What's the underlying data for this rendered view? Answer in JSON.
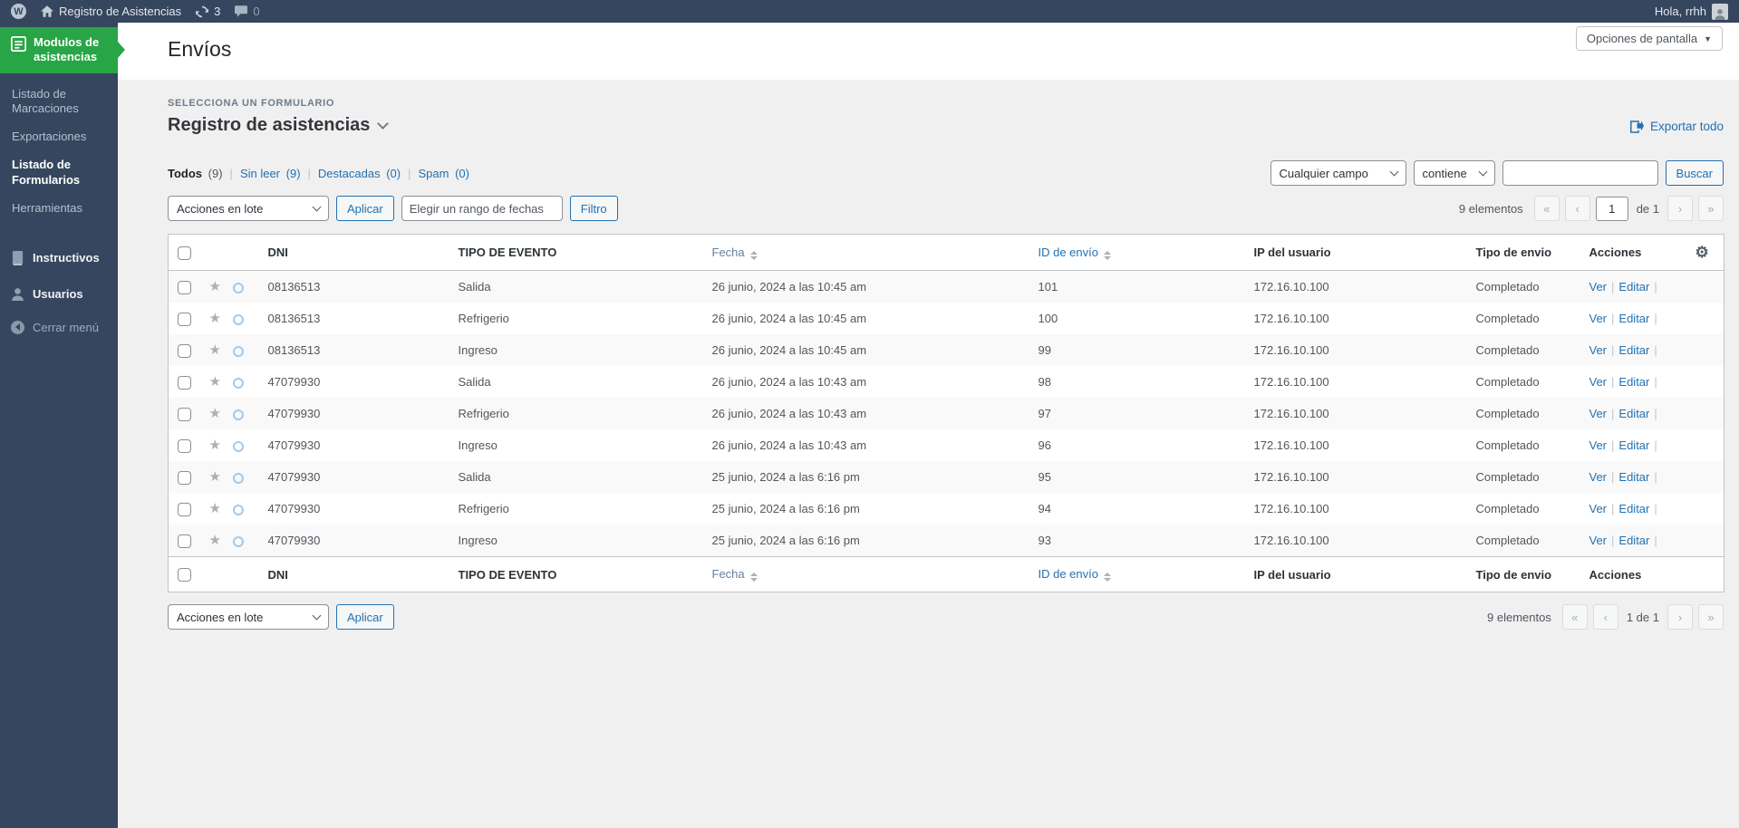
{
  "admin_bar": {
    "site_name": "Registro de Asistencias",
    "wp_logo": "W",
    "updates_count": "3",
    "comments_count": "0",
    "greeting": "Hola, rrhh"
  },
  "sidebar": {
    "main_item": "Modulos de asistencias",
    "submenu": [
      "Listado de Marcaciones",
      "Exportaciones",
      "Listado de Formularios",
      "Herramientas"
    ],
    "instructivos": "Instructivos",
    "usuarios": "Usuarios",
    "collapse": "Cerrar menú"
  },
  "page": {
    "title": "Envíos",
    "screen_options": "Opciones de pantalla",
    "form_selector_label": "Selecciona un formulario",
    "form_name": "Registro de asistencias",
    "export_all": "Exportar todo"
  },
  "views": [
    {
      "label": "Todos",
      "count": "(9)"
    },
    {
      "label": "Sin leer",
      "count": "(9)"
    },
    {
      "label": "Destacadas",
      "count": "(0)"
    },
    {
      "label": "Spam",
      "count": "(0)"
    }
  ],
  "search": {
    "field_select": "Cualquier campo",
    "operator_select": "contiene",
    "input_value": "",
    "button": "Buscar"
  },
  "bulk": {
    "actions_select": "Acciones en lote",
    "apply_button": "Aplicar",
    "date_placeholder": "Elegir un rango de fechas",
    "filter_button": "Filtro"
  },
  "pagination": {
    "items_text": "9 elementos",
    "first": "«",
    "prev": "‹",
    "next": "›",
    "last": "»",
    "top_page": "1",
    "top_of": "de 1",
    "bottom_page_text": "1 de 1"
  },
  "table": {
    "headers": {
      "dni": "DNI",
      "evento": "TIPO DE EVENTO",
      "fecha": "Fecha",
      "id": "ID de envío",
      "ip": "IP del usuario",
      "tipo": "Tipo de envio",
      "acciones": "Acciones"
    },
    "actions": {
      "view": "Ver",
      "edit": "Editar"
    },
    "rows": [
      {
        "dni": "08136513",
        "evento": "Salida",
        "fecha": "26 junio, 2024 a las 10:45 am",
        "id": "101",
        "ip": "172.16.10.100",
        "tipo": "Completado"
      },
      {
        "dni": "08136513",
        "evento": "Refrigerio",
        "fecha": "26 junio, 2024 a las 10:45 am",
        "id": "100",
        "ip": "172.16.10.100",
        "tipo": "Completado"
      },
      {
        "dni": "08136513",
        "evento": "Ingreso",
        "fecha": "26 junio, 2024 a las 10:45 am",
        "id": "99",
        "ip": "172.16.10.100",
        "tipo": "Completado"
      },
      {
        "dni": "47079930",
        "evento": "Salida",
        "fecha": "26 junio, 2024 a las 10:43 am",
        "id": "98",
        "ip": "172.16.10.100",
        "tipo": "Completado"
      },
      {
        "dni": "47079930",
        "evento": "Refrigerio",
        "fecha": "26 junio, 2024 a las 10:43 am",
        "id": "97",
        "ip": "172.16.10.100",
        "tipo": "Completado"
      },
      {
        "dni": "47079930",
        "evento": "Ingreso",
        "fecha": "26 junio, 2024 a las 10:43 am",
        "id": "96",
        "ip": "172.16.10.100",
        "tipo": "Completado"
      },
      {
        "dni": "47079930",
        "evento": "Salida",
        "fecha": "25 junio, 2024 a las 6:16 pm",
        "id": "95",
        "ip": "172.16.10.100",
        "tipo": "Completado"
      },
      {
        "dni": "47079930",
        "evento": "Refrigerio",
        "fecha": "25 junio, 2024 a las 6:16 pm",
        "id": "94",
        "ip": "172.16.10.100",
        "tipo": "Completado"
      },
      {
        "dni": "47079930",
        "evento": "Ingreso",
        "fecha": "25 junio, 2024 a las 6:16 pm",
        "id": "93",
        "ip": "172.16.10.100",
        "tipo": "Completado"
      }
    ]
  }
}
